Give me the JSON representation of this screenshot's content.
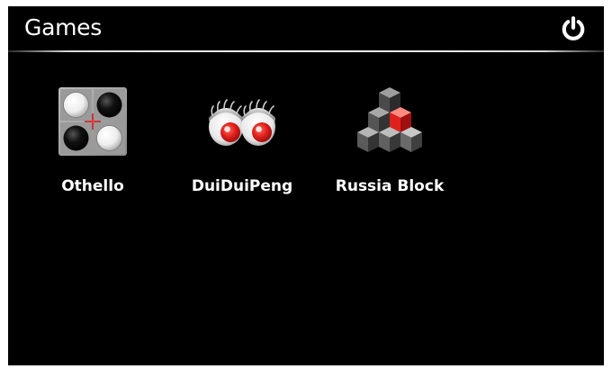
{
  "header": {
    "title": "Games",
    "power_icon": "power-icon"
  },
  "apps": [
    {
      "label": "Othello",
      "icon": "othello-icon"
    },
    {
      "label": "DuiDuiPeng",
      "icon": "duiduipeng-icon"
    },
    {
      "label": "Russia Block",
      "icon": "russia-block-icon"
    }
  ],
  "colors": {
    "background": "#000000",
    "text": "#ffffff",
    "accent_red": "#e0201c"
  }
}
